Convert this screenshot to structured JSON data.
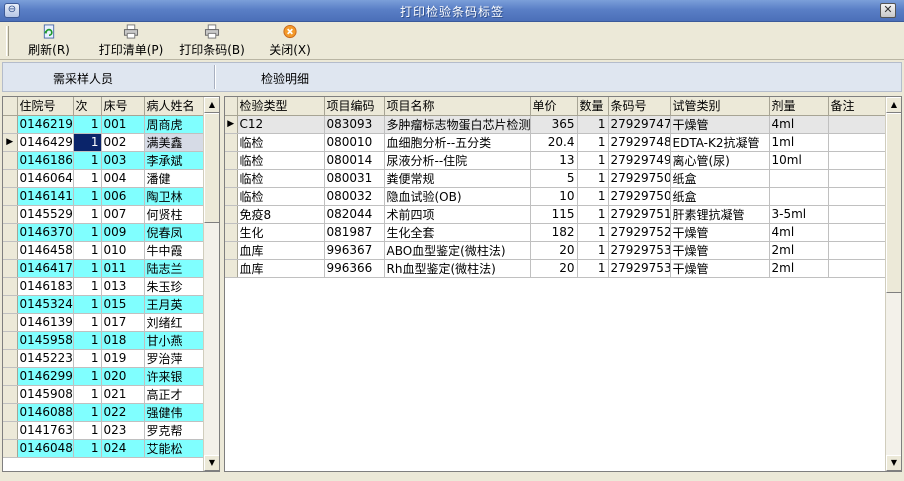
{
  "window": {
    "title": "打印检验条码标签"
  },
  "toolbar": {
    "refresh_label": "刷新(R)",
    "print_list_label": "打印清单(P)",
    "print_barcode_label": "打印条码(B)",
    "close_label": "关闭(X)"
  },
  "sections": {
    "patients_title": "需采样人员",
    "details_title": "检验明细"
  },
  "patients": {
    "headers": [
      "住院号",
      "次",
      "床号",
      "病人姓名"
    ],
    "rows": [
      {
        "id": "0146219",
        "times": "1",
        "bed": "001",
        "name": "周商虎"
      },
      {
        "id": "0146429",
        "times": "1",
        "bed": "002",
        "name": "满美鑫"
      },
      {
        "id": "0146186",
        "times": "1",
        "bed": "003",
        "name": "李承斌"
      },
      {
        "id": "0146064",
        "times": "1",
        "bed": "004",
        "name": "潘健"
      },
      {
        "id": "0146141",
        "times": "1",
        "bed": "006",
        "name": "陶卫林"
      },
      {
        "id": "0145529",
        "times": "1",
        "bed": "007",
        "name": "何贤柱"
      },
      {
        "id": "0146370",
        "times": "1",
        "bed": "009",
        "name": "倪春凤"
      },
      {
        "id": "0146458",
        "times": "1",
        "bed": "010",
        "name": "牛中霞"
      },
      {
        "id": "0146417",
        "times": "1",
        "bed": "011",
        "name": "陆志兰"
      },
      {
        "id": "0146183",
        "times": "1",
        "bed": "013",
        "name": "朱玉珍"
      },
      {
        "id": "0145324",
        "times": "1",
        "bed": "015",
        "name": "王月英"
      },
      {
        "id": "0146139",
        "times": "1",
        "bed": "017",
        "name": "刘绪红"
      },
      {
        "id": "0145958",
        "times": "1",
        "bed": "018",
        "name": "甘小燕"
      },
      {
        "id": "0145223",
        "times": "1",
        "bed": "019",
        "name": "罗治萍"
      },
      {
        "id": "0146299",
        "times": "1",
        "bed": "020",
        "name": "许来银"
      },
      {
        "id": "0145908",
        "times": "1",
        "bed": "021",
        "name": "高正才"
      },
      {
        "id": "0146088",
        "times": "1",
        "bed": "022",
        "name": "强健伟"
      },
      {
        "id": "0141763",
        "times": "1",
        "bed": "023",
        "name": "罗克帮"
      },
      {
        "id": "0146048",
        "times": "1",
        "bed": "024",
        "name": "艾能松"
      }
    ]
  },
  "details": {
    "headers": [
      "检验类型",
      "项目编码",
      "项目名称",
      "单价",
      "数量",
      "条码号",
      "试管类别",
      "剂量",
      "备注"
    ],
    "rows": [
      {
        "type": "C12",
        "code": "083093",
        "name": "多肿瘤标志物蛋白芯片检测",
        "price": "365",
        "qty": "1",
        "barcode": "27929747",
        "tube": "干燥管",
        "dose": "4ml",
        "note": ""
      },
      {
        "type": "临检",
        "code": "080010",
        "name": "血细胞分析--五分类",
        "price": "20.4",
        "qty": "1",
        "barcode": "27929748",
        "tube": "EDTA-K2抗凝管",
        "dose": "1ml",
        "note": ""
      },
      {
        "type": "临检",
        "code": "080014",
        "name": "尿液分析--住院",
        "price": "13",
        "qty": "1",
        "barcode": "27929749",
        "tube": "离心管(尿)",
        "dose": "10ml",
        "note": ""
      },
      {
        "type": "临检",
        "code": "080031",
        "name": "粪便常规",
        "price": "5",
        "qty": "1",
        "barcode": "27929750",
        "tube": "纸盒",
        "dose": "",
        "note": ""
      },
      {
        "type": "临检",
        "code": "080032",
        "name": "隐血试验(OB)",
        "price": "10",
        "qty": "1",
        "barcode": "27929750",
        "tube": "纸盒",
        "dose": "",
        "note": ""
      },
      {
        "type": "免疫8",
        "code": "082044",
        "name": "术前四项",
        "price": "115",
        "qty": "1",
        "barcode": "27929751",
        "tube": "肝素锂抗凝管",
        "dose": "3-5ml",
        "note": ""
      },
      {
        "type": "生化",
        "code": "081987",
        "name": "生化全套",
        "price": "182",
        "qty": "1",
        "barcode": "27929752",
        "tube": "干燥管",
        "dose": "4ml",
        "note": ""
      },
      {
        "type": "血库",
        "code": "996367",
        "name": "ABO血型鉴定(微柱法)",
        "price": "20",
        "qty": "1",
        "barcode": "27929753",
        "tube": "干燥管",
        "dose": "2ml",
        "note": ""
      },
      {
        "type": "血库",
        "code": "996366",
        "name": "Rh血型鉴定(微柱法)",
        "price": "20",
        "qty": "1",
        "barcode": "27929753",
        "tube": "干燥管",
        "dose": "2ml",
        "note": ""
      }
    ]
  },
  "colors": {
    "row_highlight": "#80ffff",
    "selection": "#0a246a",
    "titlebar": "#5a7fc6"
  }
}
